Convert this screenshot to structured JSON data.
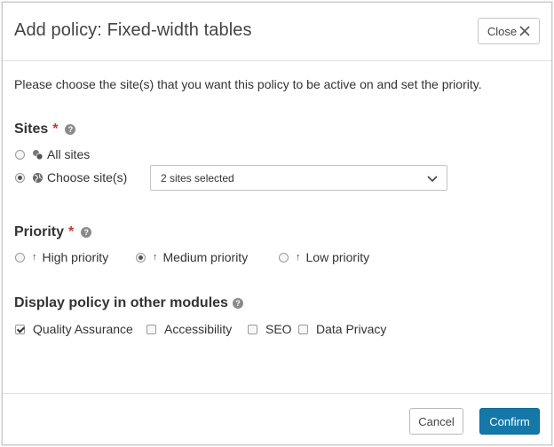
{
  "dialog": {
    "title": "Add policy: Fixed-width tables",
    "close_label": "Close"
  },
  "intro_text": "Please choose the site(s) that you want this policy to be active on and set the priority.",
  "sites": {
    "label": "Sites",
    "required_marker": "*",
    "options": [
      {
        "label": "All sites",
        "icon": "sites-group-icon",
        "selected": false
      },
      {
        "label": "Choose site(s)",
        "icon": "globe-icon",
        "selected": true
      }
    ],
    "select_value": "2 sites selected"
  },
  "priority": {
    "label": "Priority",
    "required_marker": "*",
    "options": [
      {
        "label": "High priority",
        "selected": false
      },
      {
        "label": "Medium priority",
        "selected": true
      },
      {
        "label": "Low priority",
        "selected": false
      }
    ]
  },
  "modules": {
    "label": "Display policy in other modules",
    "options": [
      {
        "label": "Quality Assurance",
        "checked": true
      },
      {
        "label": "Accessibility",
        "checked": false
      },
      {
        "label": "SEO",
        "checked": false
      },
      {
        "label": "Data Privacy",
        "checked": false
      }
    ]
  },
  "footer": {
    "cancel_label": "Cancel",
    "confirm_label": "Confirm"
  },
  "colors": {
    "primary": "#1478a8",
    "required": "#c0392b"
  }
}
